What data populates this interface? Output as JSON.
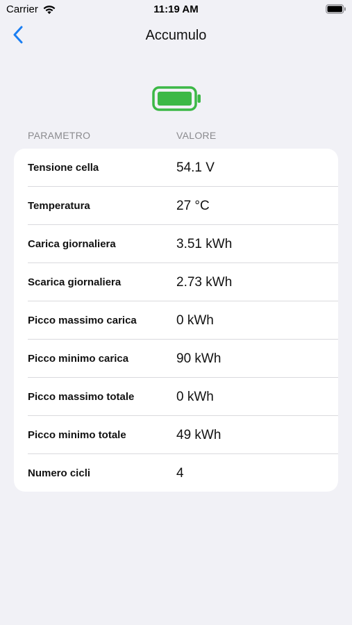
{
  "status_bar": {
    "carrier": "Carrier",
    "time": "11:19 AM",
    "wifi_icon": "wifi-icon",
    "battery_icon": "battery-full-icon"
  },
  "nav": {
    "title": "Accumulo",
    "back_icon": "chevron-left-icon",
    "accent_color": "#1a7ef2"
  },
  "hero": {
    "icon": "battery-full-icon",
    "color": "#3cb846"
  },
  "table": {
    "headers": {
      "parameter": "PARAMETRO",
      "value": "VALORE"
    },
    "rows": [
      {
        "label": "Tensione cella",
        "value": "54.1 V"
      },
      {
        "label": "Temperatura",
        "value": "27 °C"
      },
      {
        "label": "Carica giornaliera",
        "value": "3.51 kWh"
      },
      {
        "label": "Scarica giornaliera",
        "value": "2.73 kWh"
      },
      {
        "label": "Picco massimo carica",
        "value": "0 kWh"
      },
      {
        "label": "Picco minimo carica",
        "value": "90 kWh"
      },
      {
        "label": "Picco massimo totale",
        "value": "0 kWh"
      },
      {
        "label": "Picco minimo totale",
        "value": "49 kWh"
      },
      {
        "label": "Numero cicli",
        "value": "4"
      }
    ]
  }
}
